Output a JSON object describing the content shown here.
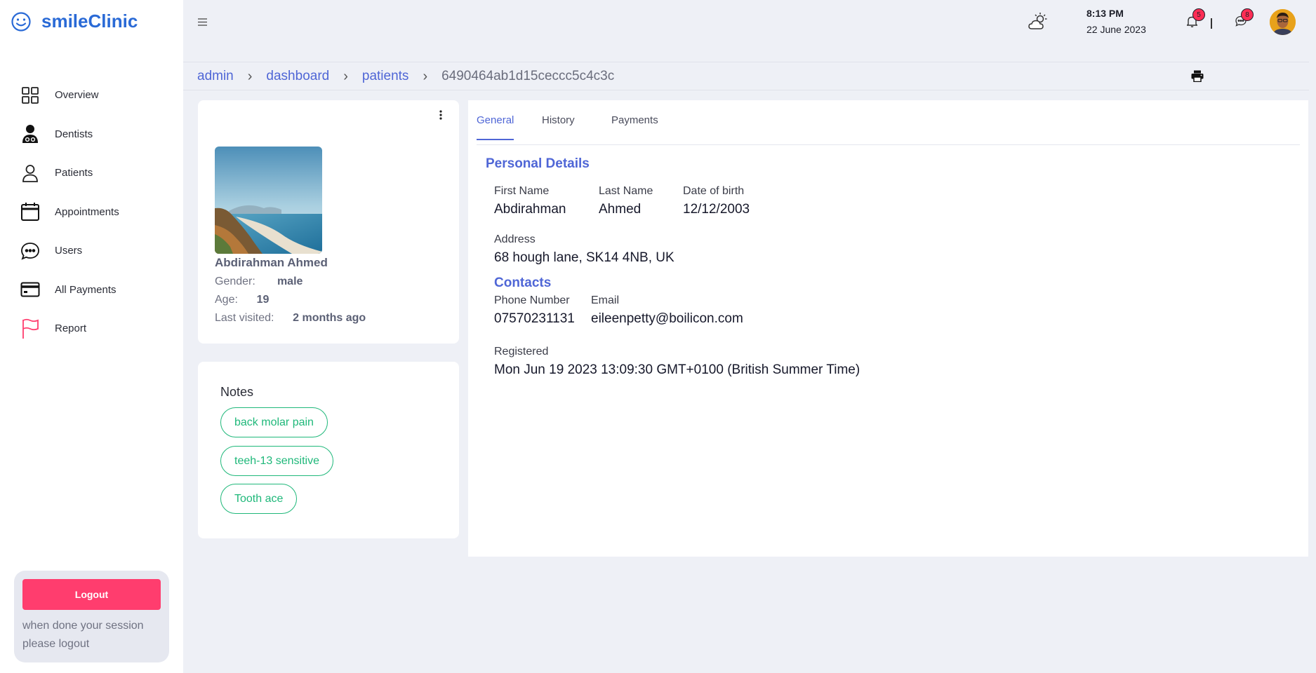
{
  "app": {
    "name": "smileClinic"
  },
  "sidebar": {
    "items": [
      {
        "label": "Overview",
        "icon": "grid-icon"
      },
      {
        "label": "Dentists",
        "icon": "doctor-icon"
      },
      {
        "label": "Patients",
        "icon": "user-icon"
      },
      {
        "label": "Appointments",
        "icon": "calendar-icon"
      },
      {
        "label": "Users",
        "icon": "chat-icon"
      },
      {
        "label": "All Payments",
        "icon": "card-icon"
      },
      {
        "label": "Report",
        "icon": "flag-icon"
      }
    ],
    "logout_label": "Logout",
    "logout_hint": "when done your session please logout"
  },
  "header": {
    "time": "8:13 PM",
    "date": "22 June 2023",
    "notifications_count": "5",
    "messages_count": "8"
  },
  "breadcrumb": {
    "items": [
      "admin",
      "dashboard",
      "patients"
    ],
    "current": "6490464ab1d15ceccc5c4c3c"
  },
  "patient": {
    "name": "Abdirahman Ahmed",
    "gender_label": "Gender:",
    "gender": "male",
    "age_label": "Age:",
    "age": "19",
    "last_visited_label": "Last visited:",
    "last_visited": "2 months ago"
  },
  "notes": {
    "title": "Notes",
    "items": [
      "back molar pain",
      "teeh-13 sensitive",
      "Tooth ace"
    ]
  },
  "tabs": [
    {
      "label": "General",
      "active": true
    },
    {
      "label": "History",
      "active": false
    },
    {
      "label": "Payments",
      "active": false
    }
  ],
  "details": {
    "personal_title": "Personal Details",
    "first_name_label": "First Name",
    "first_name": "Abdirahman",
    "last_name_label": "Last Name",
    "last_name": "Ahmed",
    "dob_label": "Date of birth",
    "dob": "12/12/2003",
    "address_label": "Address",
    "address": "68 hough lane, SK14 4NB, UK",
    "contacts_title": "Contacts",
    "phone_label": "Phone Number",
    "phone": "07570231131",
    "email_label": "Email",
    "email": "eileenpetty@boilicon.com",
    "registered_label": "Registered",
    "registered": "Mon Jun 19 2023 13:09:30 GMT+0100 (British Summer Time)"
  },
  "colors": {
    "accent": "#4f66d6",
    "brand": "#2a6ad6",
    "logout": "#ff3d6e",
    "note_chip": "#1fb87a"
  }
}
